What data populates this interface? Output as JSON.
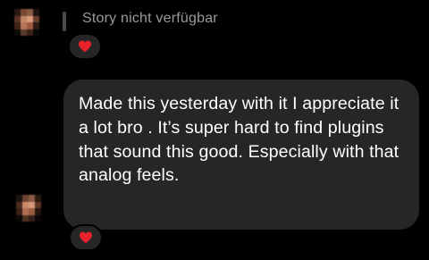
{
  "thread": {
    "story_reply_label": "Story nicht verfügbar",
    "message_text": "Made this yesterday with it I appreciate it a lot bro . It’s super hard to find plugins that sound this good. Especially with that analog feels.",
    "reactions": [
      {
        "emoji": "heart-emoji"
      },
      {
        "emoji": "heart-emoji"
      }
    ]
  },
  "colors": {
    "background": "#000000",
    "bubble": "#262626",
    "message_text": "#ffffff",
    "story_label": "#9a9a9a",
    "heart": "#e8202a"
  }
}
